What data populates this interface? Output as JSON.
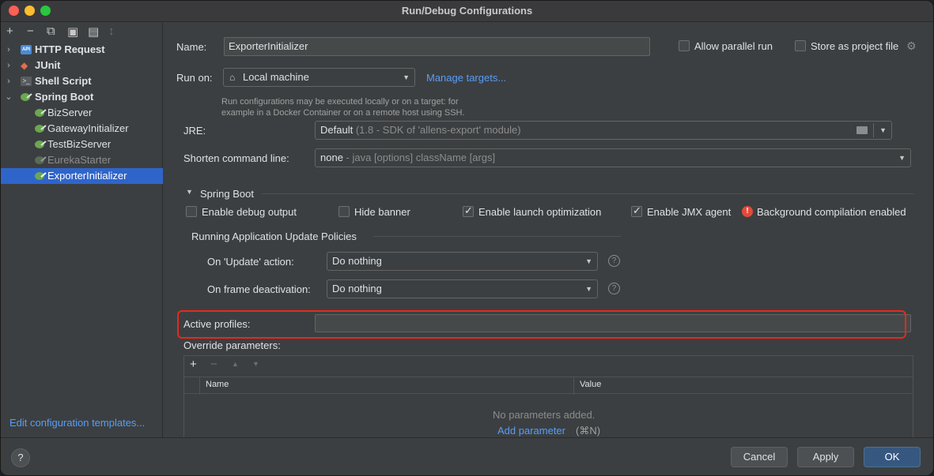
{
  "window": {
    "title": "Run/Debug Configurations"
  },
  "left": {
    "toolbar": {
      "add": "+",
      "remove": "−",
      "copy": "⧉",
      "save": "▣",
      "folder": "▤",
      "sort": "↕"
    },
    "items": [
      {
        "label": "HTTP Request"
      },
      {
        "label": "JUnit"
      },
      {
        "label": "Shell Script"
      },
      {
        "label": "Spring Boot"
      },
      {
        "label": "BizServer"
      },
      {
        "label": "GatewayInitializer"
      },
      {
        "label": "TestBizServer"
      },
      {
        "label": "EurekaStarter"
      },
      {
        "label": "ExporterInitializer"
      }
    ],
    "api_badge": "API",
    "shell_badge": ">_",
    "junit_badge": "◆",
    "edit_templates": "Edit configuration templates..."
  },
  "form": {
    "name_label": "Name:",
    "name_value": "ExporterInitializer",
    "allow_parallel": "Allow parallel run",
    "store_project": "Store as project file",
    "run_on_label": "Run on:",
    "run_on_value": "Local machine",
    "manage_targets": "Manage targets...",
    "hint_line1": "Run configurations may be executed locally or on a target: for",
    "hint_line2": "example in a Docker Container or on a remote host using SSH.",
    "jre_label": "JRE:",
    "jre_value": "Default",
    "jre_detail": "(1.8 - SDK of 'allens-export' module)",
    "shorten_label": "Shorten command line:",
    "shorten_value": "none",
    "shorten_detail": "- java [options] className [args]",
    "spring_boot_section": "Spring Boot",
    "enable_debug": "Enable debug output",
    "hide_banner": "Hide banner",
    "enable_launch": "Enable launch optimization",
    "enable_jmx": "Enable JMX agent",
    "background_compile": "Background compilation enabled",
    "update_policies": "Running Application Update Policies",
    "on_update_label": "On 'Update' action:",
    "on_update_value": "Do nothing",
    "on_frame_label": "On frame deactivation:",
    "on_frame_value": "Do nothing",
    "active_profiles_label": "Active profiles:",
    "active_profiles_value": "",
    "override_label": "Override parameters:",
    "table_add": "+",
    "table_remove": "−",
    "table_up": "▲",
    "table_down": "▼",
    "col_name": "Name",
    "col_value": "Value",
    "no_params": "No parameters added.",
    "add_param": "Add parameter",
    "add_param_shortcut": "(⌘N)"
  },
  "buttons": {
    "help": "?",
    "cancel": "Cancel",
    "apply": "Apply",
    "ok": "OK"
  }
}
